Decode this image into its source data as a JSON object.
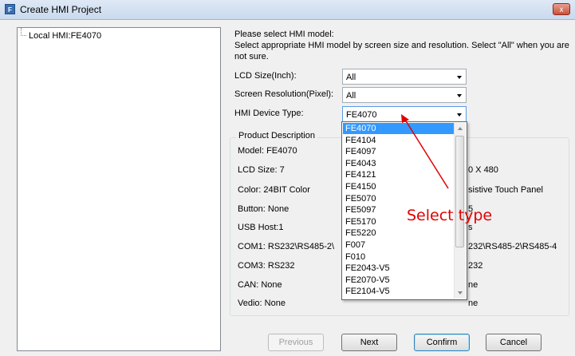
{
  "window": {
    "title": "Create HMI Project",
    "icon": "app-icon",
    "close_label": "x"
  },
  "tree": {
    "item": "Local HMI:FE4070"
  },
  "prompt": {
    "line1": "Please select HMI model:",
    "line2": "Select appropriate HMI model by screen size and resolution. Select \"All\" when you are not sure."
  },
  "fields": {
    "lcd_label": "LCD Size(Inch):",
    "lcd_value": "All",
    "res_label": "Screen Resolution(Pixel):",
    "res_value": "All",
    "type_label": "HMI Device Type:",
    "type_value": "FE4070"
  },
  "product": {
    "title": "Product Description",
    "model": "Model:   FE4070",
    "lcd": "LCD Size: 7",
    "color": "Color:     24BIT Color",
    "button": "Button:   None",
    "usb": "USB Host:1",
    "com1": "COM1:   RS232\\RS485-2\\",
    "com3": "COM3:   RS232",
    "can": "CAN:      None",
    "vedio": "Vedio:    None",
    "r_res": "0 X 480",
    "r_touch": "sistive Touch Panel",
    "r_s1": "5",
    "r_s2": "s",
    "r_com": "232\\RS485-2\\RS485-4",
    "r_com3": "232",
    "r_can": "ne",
    "r_vedio": "ne"
  },
  "dropdown": {
    "items": [
      "FE4070",
      "FE4104",
      "FE4097",
      "FE4043",
      "FE4121",
      "FE4150",
      "FE5070",
      "FE5097",
      "FE5170",
      "FE5220",
      "F007",
      "F010",
      "FE2043-V5",
      "FE2070-V5",
      "FE2104-V5"
    ],
    "selected": "FE4070"
  },
  "annotation": {
    "text": "Select type",
    "color": "#e00000"
  },
  "buttons": {
    "previous": "Previous",
    "next": "Next",
    "confirm": "Confirm",
    "cancel": "Cancel"
  }
}
